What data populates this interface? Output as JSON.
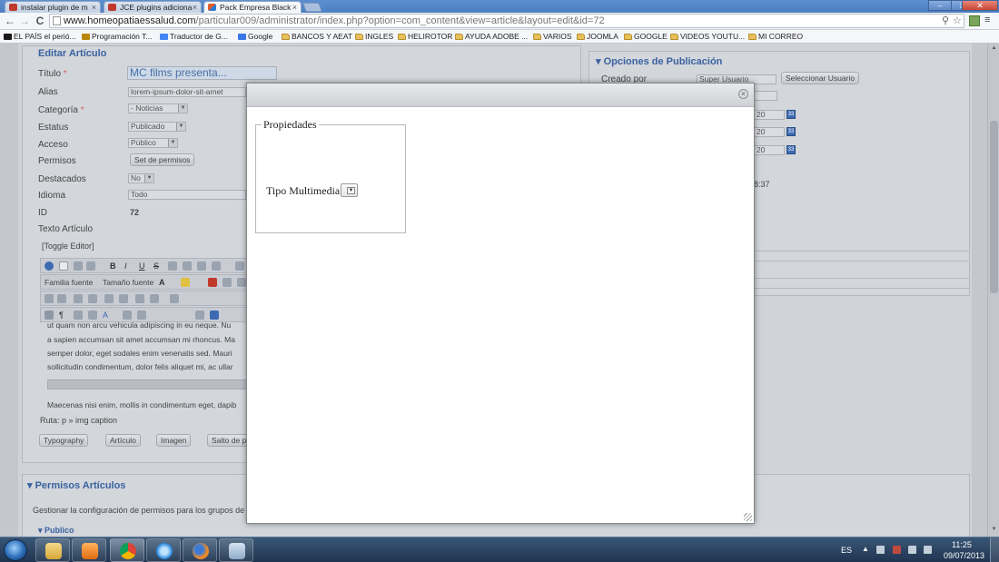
{
  "browser": {
    "tabs": [
      {
        "title": "instalar plugin de m",
        "active": false
      },
      {
        "title": "JCE plugins adiciona",
        "active": false
      },
      {
        "title": "Pack Empresa Black",
        "active": true
      }
    ],
    "window_controls": {
      "minimize": "–",
      "maximize": "□",
      "close": "✕"
    },
    "nav": {
      "back": "←",
      "forward": "→",
      "reload": "C"
    },
    "url_host": "www.homeopatiaessalud.com",
    "url_path": "/particular009/administrator/index.php?option=com_content&view=article&layout=edit&id=72",
    "bookmarks": [
      {
        "label": "EL PAÍS el perió...",
        "type": "site",
        "color": "#1a1a1a"
      },
      {
        "label": "Programación T...",
        "type": "site",
        "color": "#b8860b"
      },
      {
        "label": "Traductor de G...",
        "type": "site",
        "color": "#4285f4"
      },
      {
        "label": "Google",
        "type": "site",
        "color": "#3b78e7"
      },
      {
        "label": "BANCOS Y AEAT",
        "type": "folder"
      },
      {
        "label": "INGLES",
        "type": "folder"
      },
      {
        "label": "HELIROTOR",
        "type": "folder"
      },
      {
        "label": "AYUDA ADOBE ...",
        "type": "folder"
      },
      {
        "label": "VARIOS",
        "type": "folder"
      },
      {
        "label": "JOOMLA",
        "type": "folder"
      },
      {
        "label": "GOOGLE",
        "type": "folder"
      },
      {
        "label": "VIDEOS YOUTU...",
        "type": "folder"
      },
      {
        "label": "MI CORREO",
        "type": "folder"
      }
    ]
  },
  "article": {
    "panel_title": "Editar Artículo",
    "fields": [
      {
        "label": "Título",
        "required": true,
        "value": "MC films presenta..."
      },
      {
        "label": "Alias",
        "required": false,
        "value": "lorem-ipsum-dolor-sit-amet"
      },
      {
        "label": "Categoría",
        "required": true,
        "value": "- Noticias"
      },
      {
        "label": "Estatus",
        "required": false,
        "value": "Publicado"
      },
      {
        "label": "Acceso",
        "required": false,
        "value": "Público"
      },
      {
        "label": "Permisos",
        "required": false,
        "value": "Set de permisos"
      },
      {
        "label": "Destacados",
        "required": false,
        "value": "No"
      },
      {
        "label": "Idioma",
        "required": false,
        "value": "Todo"
      },
      {
        "label": "ID",
        "required": false,
        "value": "72"
      }
    ],
    "texto_label": "Texto Artículo",
    "toggle_editor": "[Toggle Editor]",
    "font_family": "Familia fuente",
    "font_size": "Tamaño fuente",
    "body_lines": [
      "ut quam non arcu vehicula adipiscing in eu neque. Nu",
      "a sapien accumsan sit amet accumsan mi rhoncus. Ma",
      "semper dolor, eget sodales enim venenatis sed. Mauri",
      "sollicitudin condimentum, dolor felis aliquet mi, ac ullar"
    ],
    "body_line_after": "Maecenas nisi enim, mollis in condimentum eget, dapib",
    "path": "Ruta:  p » img caption",
    "editor_buttons": [
      "Typography",
      "Artículo",
      "Imagen",
      "Salto de p"
    ]
  },
  "publishing": {
    "panel_title": "Opciones de Publicación",
    "created_by_label": "Creado por",
    "created_by_value": "Super Usuario",
    "select_user": "Seleccionar Usuario",
    "date_suffixes": [
      "20",
      "20",
      "20"
    ],
    "time_fragment": "8:37"
  },
  "permissions": {
    "section_title": "Permisos Artículos",
    "description": "Gestionar la configuración de permisos para los grupos de usu",
    "group": "Publico"
  },
  "modal": {
    "legend": "Propiedades",
    "field_label": "Tipo Multimedia",
    "close_symbol": "×"
  },
  "taskbar": {
    "lang": "ES",
    "time": "11:25",
    "date": "09/07/2013"
  },
  "colors": {
    "tabstrip": "#4c7fc0",
    "panel_title": "#3a62a0",
    "taskbar": "#1f3450"
  }
}
